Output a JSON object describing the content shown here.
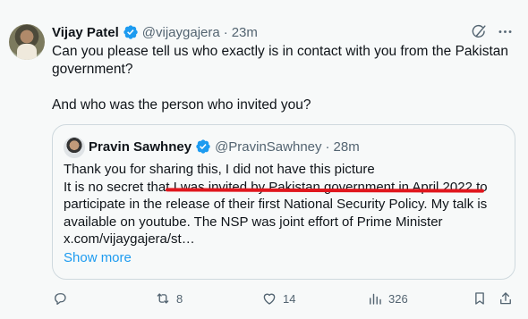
{
  "author": {
    "name": "Vijay Patel",
    "handle": "@vijaygajera",
    "time": "23m"
  },
  "tweet": {
    "line1": "Can you please tell us who exactly is in contact with you from the Pakistan government?",
    "line2": "And who was the person who invited you?"
  },
  "quote": {
    "name": "Pravin Sawhney",
    "handle": "@PravinSawhney",
    "time": "28m",
    "body_before": "Thank you for sharing this, I did not have this picture\nIt is no secret that ",
    "body_underlined": "I was invited by Pakistan government in April 2022",
    "body_after": " to participate in the release of their first National Security Policy. My talk is available on youtube. The NSP was joint effort of Prime Minister x.com/vijaygajera/st…",
    "show_more": "Show more"
  },
  "actions": {
    "replies": "",
    "reposts": "8",
    "likes": "14",
    "views": "326"
  },
  "separator": "·",
  "colors": {
    "accent": "#1d9bf0",
    "muted": "#536471",
    "underline": "#e0161d"
  },
  "icons": [
    "verified-badge-icon",
    "grok-icon",
    "more-icon",
    "reply-icon",
    "repost-icon",
    "like-icon",
    "views-icon",
    "bookmark-icon",
    "share-icon"
  ]
}
